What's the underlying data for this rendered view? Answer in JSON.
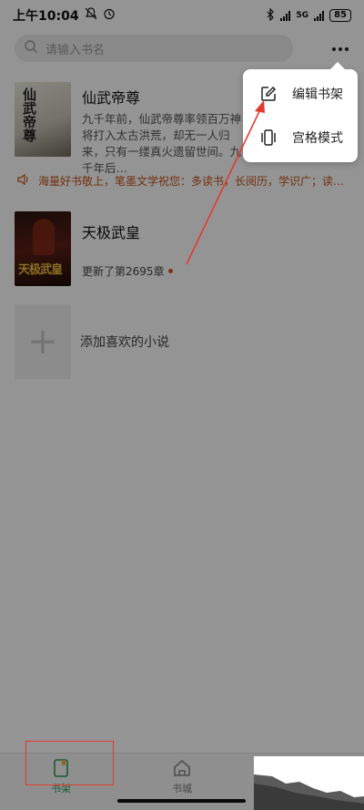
{
  "status_bar": {
    "time": "上午10:04",
    "battery": "85",
    "network": "5G"
  },
  "search": {
    "placeholder": "请输入书名"
  },
  "books": [
    {
      "title": "仙武帝尊",
      "cover_text": "仙武帝尊",
      "description": "九千年前，仙武帝尊率领百万神将打入太古洪荒，却无一人归来，只有一缕真火遗留世间。九千年后…"
    },
    {
      "title": "天极武皇",
      "cover_text": "天极武皇",
      "update": "更新了第2695章"
    }
  ],
  "notice": {
    "text": "海量好书敬上，笔墨文学祝您：多读书，长阅历，学识广；读…"
  },
  "add_book": {
    "label": "添加喜欢的小说"
  },
  "popup_menu": {
    "items": [
      {
        "label": "编辑书架",
        "icon": "edit-icon"
      },
      {
        "label": "宫格模式",
        "icon": "grid-mode-icon"
      }
    ]
  },
  "bottom_nav": {
    "items": [
      {
        "label": "书架",
        "icon": "bookshelf-icon",
        "active": true
      },
      {
        "label": "书城",
        "icon": "home-icon",
        "active": false
      }
    ]
  },
  "colors": {
    "accent": "#2d9a5a",
    "notice": "#c4531a",
    "annotation": "#e23b2e"
  }
}
